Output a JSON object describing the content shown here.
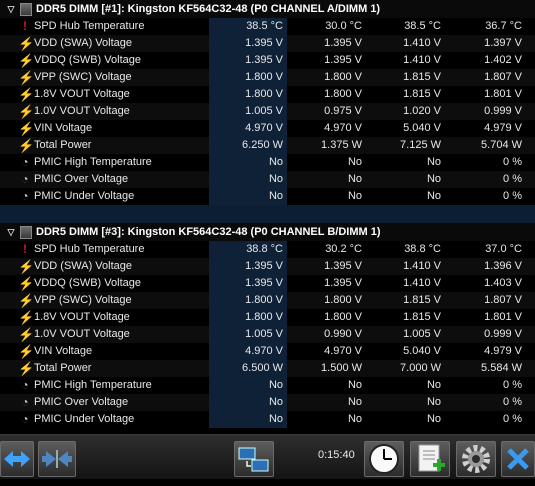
{
  "sections": [
    {
      "title": "DDR5 DIMM [#1]: Kingston KF564C32-48 (P0 CHANNEL A/DIMM 1)",
      "rows": [
        {
          "icon": "thermometer-icon",
          "label": "SPD Hub Temperature",
          "values": [
            "38.5 °C",
            "30.0 °C",
            "38.5 °C",
            "36.7 °C"
          ]
        },
        {
          "icon": "voltage-icon",
          "label": "VDD (SWA) Voltage",
          "values": [
            "1.395 V",
            "1.395 V",
            "1.410 V",
            "1.397 V"
          ]
        },
        {
          "icon": "voltage-icon",
          "label": "VDDQ (SWB) Voltage",
          "values": [
            "1.395 V",
            "1.395 V",
            "1.410 V",
            "1.402 V"
          ]
        },
        {
          "icon": "voltage-icon",
          "label": "VPP (SWC) Voltage",
          "values": [
            "1.800 V",
            "1.800 V",
            "1.815 V",
            "1.807 V"
          ]
        },
        {
          "icon": "voltage-icon",
          "label": "1.8V VOUT Voltage",
          "values": [
            "1.800 V",
            "1.800 V",
            "1.815 V",
            "1.801 V"
          ]
        },
        {
          "icon": "voltage-icon",
          "label": "1.0V VOUT Voltage",
          "values": [
            "1.005 V",
            "0.975 V",
            "1.020 V",
            "0.999 V"
          ]
        },
        {
          "icon": "voltage-icon",
          "label": "VIN Voltage",
          "values": [
            "4.970 V",
            "4.970 V",
            "5.040 V",
            "4.979 V"
          ]
        },
        {
          "icon": "voltage-icon",
          "label": "Total Power",
          "values": [
            "6.250 W",
            "1.375 W",
            "7.125 W",
            "5.704 W"
          ]
        },
        {
          "icon": "clock-icon",
          "label": "PMIC High Temperature",
          "values": [
            "No",
            "No",
            "No",
            "0 %"
          ]
        },
        {
          "icon": "clock-icon",
          "label": "PMIC Over Voltage",
          "values": [
            "No",
            "No",
            "No",
            "0 %"
          ]
        },
        {
          "icon": "clock-icon",
          "label": "PMIC Under Voltage",
          "values": [
            "No",
            "No",
            "No",
            "0 %"
          ]
        }
      ]
    },
    {
      "title": "DDR5 DIMM [#3]: Kingston KF564C32-48 (P0 CHANNEL B/DIMM 1)",
      "rows": [
        {
          "icon": "thermometer-icon",
          "label": "SPD Hub Temperature",
          "values": [
            "38.8 °C",
            "30.2 °C",
            "38.8 °C",
            "37.0 °C"
          ]
        },
        {
          "icon": "voltage-icon",
          "label": "VDD (SWA) Voltage",
          "values": [
            "1.395 V",
            "1.395 V",
            "1.410 V",
            "1.396 V"
          ]
        },
        {
          "icon": "voltage-icon",
          "label": "VDDQ (SWB) Voltage",
          "values": [
            "1.395 V",
            "1.395 V",
            "1.410 V",
            "1.403 V"
          ]
        },
        {
          "icon": "voltage-icon",
          "label": "VPP (SWC) Voltage",
          "values": [
            "1.800 V",
            "1.800 V",
            "1.815 V",
            "1.807 V"
          ]
        },
        {
          "icon": "voltage-icon",
          "label": "1.8V VOUT Voltage",
          "values": [
            "1.800 V",
            "1.800 V",
            "1.815 V",
            "1.801 V"
          ]
        },
        {
          "icon": "voltage-icon",
          "label": "1.0V VOUT Voltage",
          "values": [
            "1.005 V",
            "0.990 V",
            "1.005 V",
            "0.999 V"
          ]
        },
        {
          "icon": "voltage-icon",
          "label": "VIN Voltage",
          "values": [
            "4.970 V",
            "4.970 V",
            "5.040 V",
            "4.979 V"
          ]
        },
        {
          "icon": "voltage-icon",
          "label": "Total Power",
          "values": [
            "6.500 W",
            "1.500 W",
            "7.000 W",
            "5.584 W"
          ]
        },
        {
          "icon": "clock-icon",
          "label": "PMIC High Temperature",
          "values": [
            "No",
            "No",
            "No",
            "0 %"
          ]
        },
        {
          "icon": "clock-icon",
          "label": "PMIC Over Voltage",
          "values": [
            "No",
            "No",
            "No",
            "0 %"
          ]
        },
        {
          "icon": "clock-icon",
          "label": "PMIC Under Voltage",
          "values": [
            "No",
            "No",
            "No",
            "0 %"
          ]
        }
      ]
    }
  ],
  "toolbar": {
    "elapsed_time": "0:15:40",
    "buttons": [
      "nav-left-right-icon",
      "collapse-arrows-icon",
      "network-computers-icon",
      "clock-icon",
      "add-report-icon",
      "gear-icon",
      "close-icon"
    ]
  },
  "colors": {
    "current_column_bg": "#0f2137",
    "section_divider": "#0c1e32",
    "temp_icon": "#d21c1c",
    "voltage_icon": "#f0c020"
  }
}
